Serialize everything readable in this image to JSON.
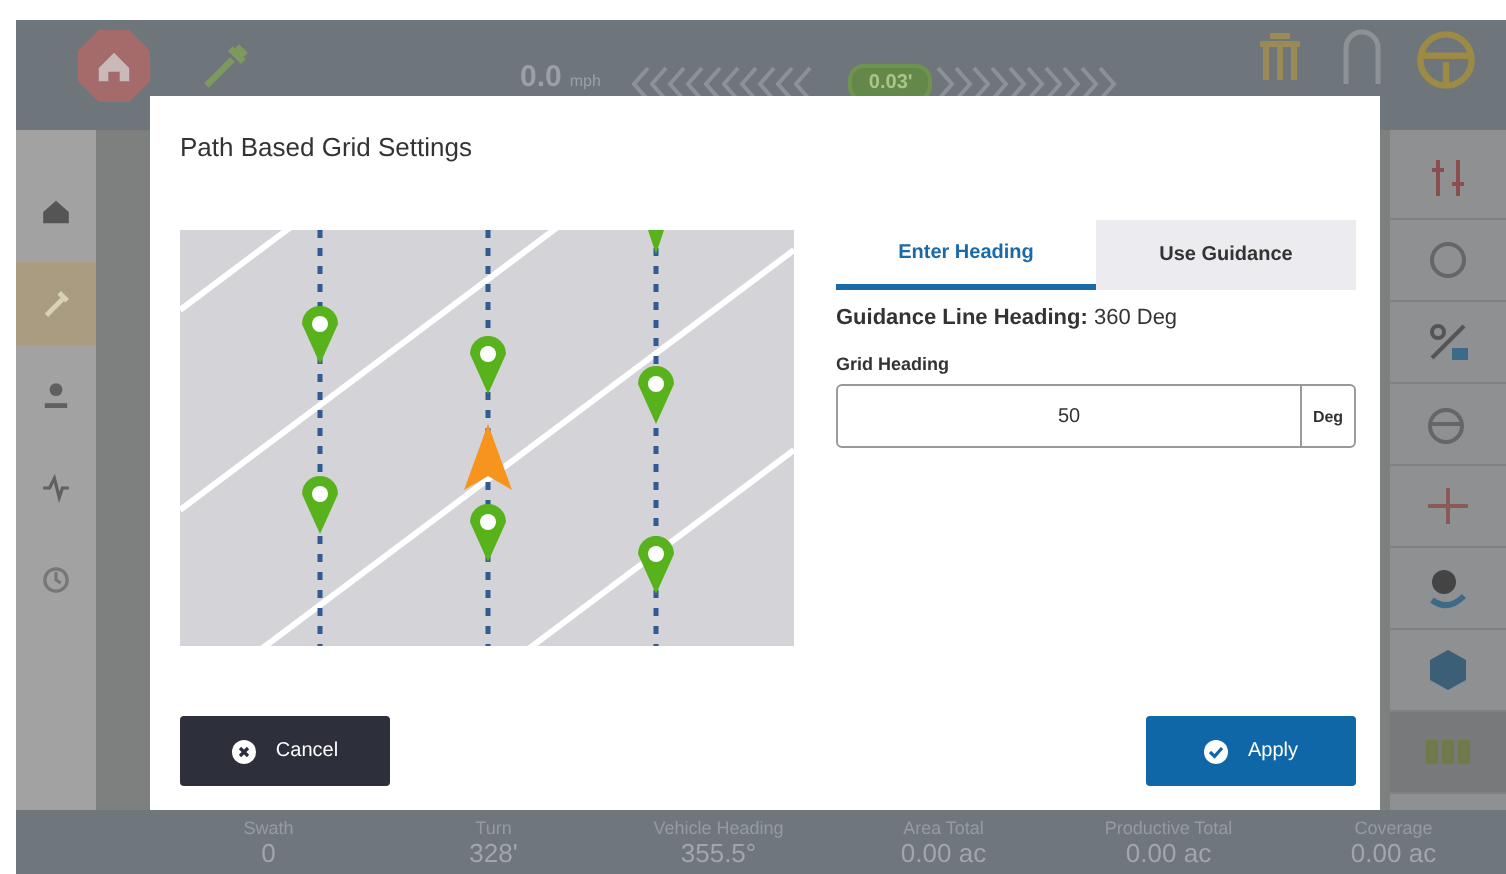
{
  "top_bar": {
    "speed": "0.0",
    "speed_unit": "mph",
    "offset": "0.03'"
  },
  "sidebar": {
    "items": [
      {
        "selected": false
      },
      {
        "selected": true
      },
      {
        "selected": false
      },
      {
        "selected": false
      },
      {
        "selected": false
      }
    ]
  },
  "status_bar": [
    {
      "label": "Swath",
      "value": "0"
    },
    {
      "label": "Turn",
      "value": "328'"
    },
    {
      "label": "Vehicle Heading",
      "value": "355.5°"
    },
    {
      "label": "Area Total",
      "value": "0.00 ac"
    },
    {
      "label": "Productive Total",
      "value": "0.00 ac"
    },
    {
      "label": "Coverage",
      "value": "0.00 ac"
    }
  ],
  "dialog": {
    "title": "Path Based Grid Settings",
    "tabs": [
      {
        "label": "Enter Heading",
        "selected": true
      },
      {
        "label": "Use Guidance",
        "selected": false
      }
    ],
    "guidance_line_heading": {
      "label": "Guidance Line Heading:",
      "value": "360 Deg"
    },
    "grid_heading": {
      "label": "Grid Heading",
      "value": "50",
      "unit": "Deg"
    },
    "buttons": [
      {
        "label": "Cancel",
        "kind": "cancel"
      },
      {
        "label": "Apply",
        "kind": "apply"
      }
    ]
  }
}
